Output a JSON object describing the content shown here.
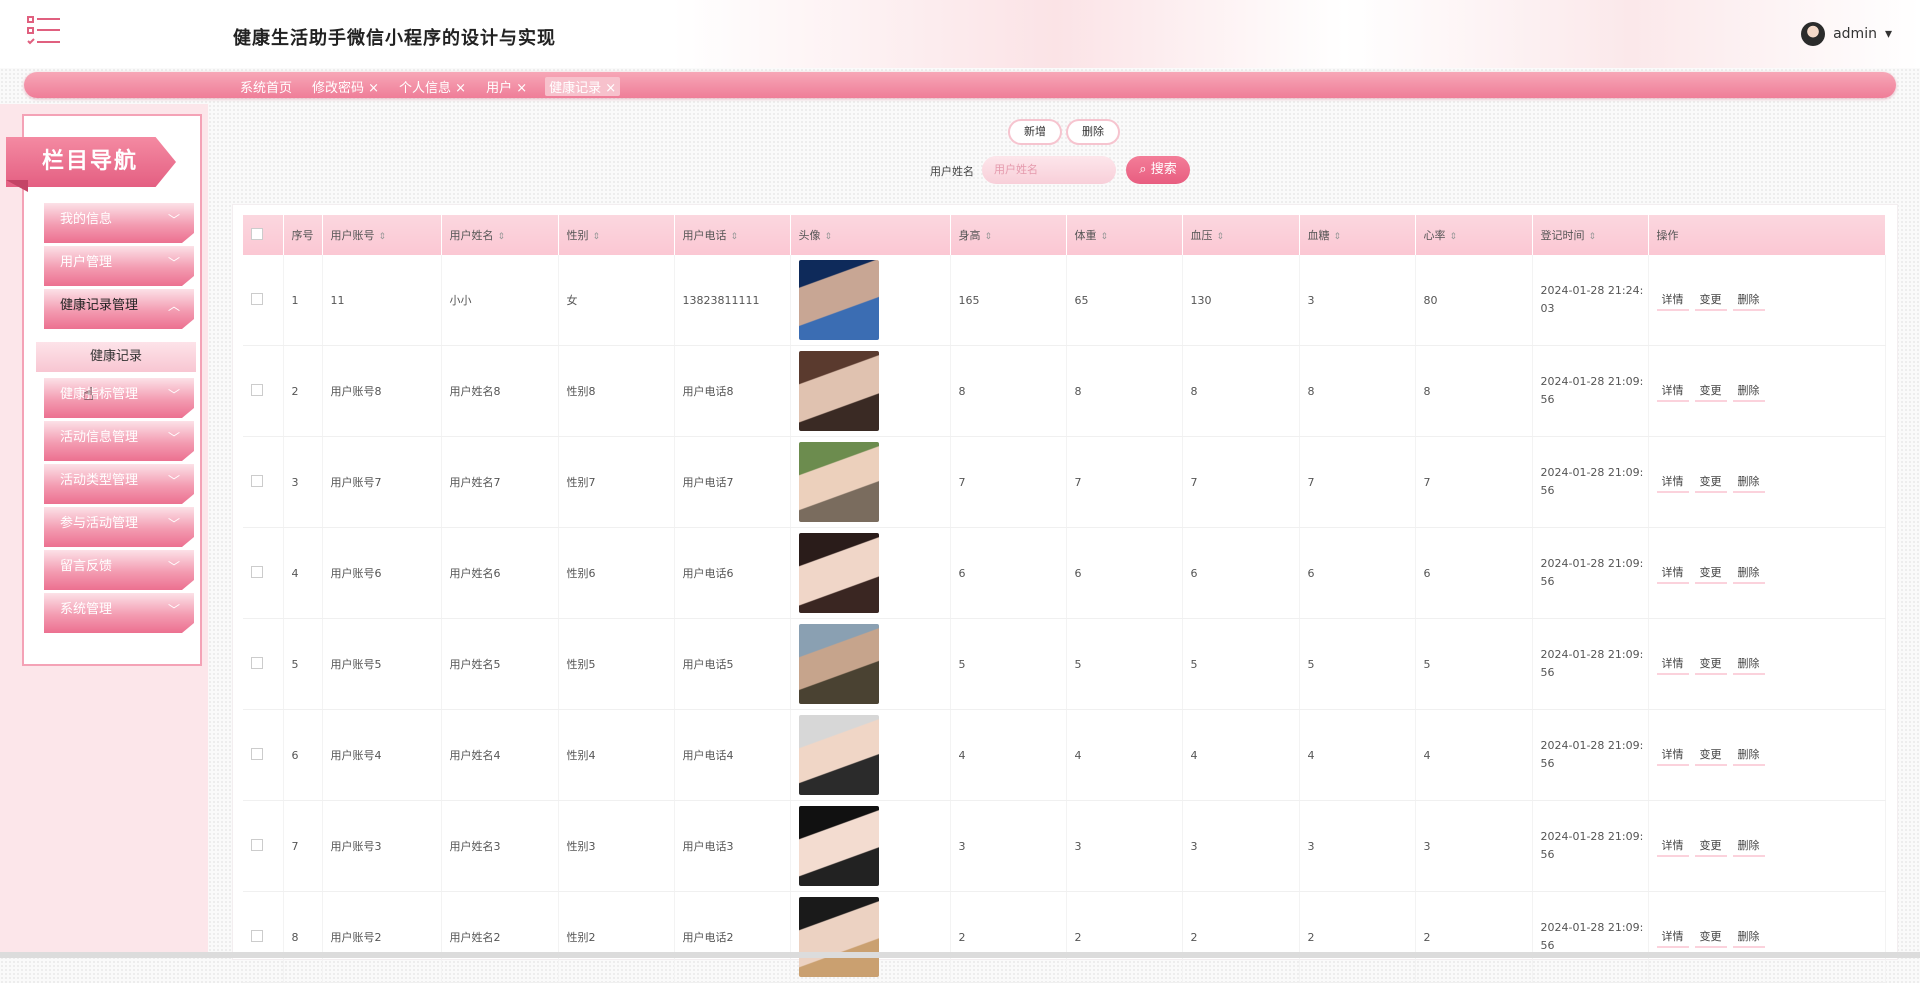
{
  "header": {
    "title": "健康生活助手微信小程序的设计与实现",
    "user": "admin"
  },
  "tabs": [
    {
      "label": "系统首页"
    },
    {
      "label": "修改密码 ×"
    },
    {
      "label": "个人信息 ×"
    },
    {
      "label": "用户 ×"
    },
    {
      "label": "健康记录 ×"
    }
  ],
  "sidebar": {
    "heading": "栏目导航",
    "items": [
      {
        "label": "我的信息",
        "chevron": "﹀"
      },
      {
        "label": "用户管理",
        "chevron": "﹀"
      },
      {
        "label": "健康记录管理",
        "chevron": "︿"
      },
      {
        "label": "健康指标管理",
        "chevron": "﹀"
      },
      {
        "label": "活动信息管理",
        "chevron": "﹀"
      },
      {
        "label": "活动类型管理",
        "chevron": "﹀"
      },
      {
        "label": "参与活动管理",
        "chevron": "﹀"
      },
      {
        "label": "留言反馈",
        "chevron": "﹀"
      },
      {
        "label": "系统管理",
        "chevron": "﹀"
      }
    ],
    "sub_item": "健康记录"
  },
  "toolbar": {
    "add": "新增",
    "delete": "删除",
    "search_label": "用户姓名",
    "search_placeholder": "用户姓名",
    "search_button": "搜索"
  },
  "table": {
    "headers": [
      "序号",
      "用户账号",
      "用户姓名",
      "性别",
      "用户电话",
      "头像",
      "身高",
      "体重",
      "血压",
      "血糖",
      "心率",
      "登记时间",
      "操作"
    ],
    "actions": [
      "详情",
      "变更",
      "删除"
    ],
    "rows": [
      {
        "idx": "1",
        "account": "11",
        "name": "小小",
        "gender": "女",
        "phone": "13823811111",
        "height": "165",
        "weight": "65",
        "bp": "130",
        "sugar": "3",
        "rate": "80",
        "time1": "2024-01-28 21:24:",
        "time2": "03"
      },
      {
        "idx": "2",
        "account": "用户账号8",
        "name": "用户姓名8",
        "gender": "性别8",
        "phone": "用户电话8",
        "height": "8",
        "weight": "8",
        "bp": "8",
        "sugar": "8",
        "rate": "8",
        "time1": "2024-01-28 21:09:",
        "time2": "56"
      },
      {
        "idx": "3",
        "account": "用户账号7",
        "name": "用户姓名7",
        "gender": "性别7",
        "phone": "用户电话7",
        "height": "7",
        "weight": "7",
        "bp": "7",
        "sugar": "7",
        "rate": "7",
        "time1": "2024-01-28 21:09:",
        "time2": "56"
      },
      {
        "idx": "4",
        "account": "用户账号6",
        "name": "用户姓名6",
        "gender": "性别6",
        "phone": "用户电话6",
        "height": "6",
        "weight": "6",
        "bp": "6",
        "sugar": "6",
        "rate": "6",
        "time1": "2024-01-28 21:09:",
        "time2": "56"
      },
      {
        "idx": "5",
        "account": "用户账号5",
        "name": "用户姓名5",
        "gender": "性别5",
        "phone": "用户电话5",
        "height": "5",
        "weight": "5",
        "bp": "5",
        "sugar": "5",
        "rate": "5",
        "time1": "2024-01-28 21:09:",
        "time2": "56"
      },
      {
        "idx": "6",
        "account": "用户账号4",
        "name": "用户姓名4",
        "gender": "性别4",
        "phone": "用户电话4",
        "height": "4",
        "weight": "4",
        "bp": "4",
        "sugar": "4",
        "rate": "4",
        "time1": "2024-01-28 21:09:",
        "time2": "56"
      },
      {
        "idx": "7",
        "account": "用户账号3",
        "name": "用户姓名3",
        "gender": "性别3",
        "phone": "用户电话3",
        "height": "3",
        "weight": "3",
        "bp": "3",
        "sugar": "3",
        "rate": "3",
        "time1": "2024-01-28 21:09:",
        "time2": "56"
      },
      {
        "idx": "8",
        "account": "用户账号2",
        "name": "用户姓名2",
        "gender": "性别2",
        "phone": "用户电话2",
        "height": "2",
        "weight": "2",
        "bp": "2",
        "sugar": "2",
        "rate": "2",
        "time1": "2024-01-28 21:09:",
        "time2": "56"
      }
    ]
  },
  "colors": {
    "accent": "#ef7d98",
    "accent_light": "#fbd7df",
    "sidebar_bg": "#fce6ea"
  }
}
